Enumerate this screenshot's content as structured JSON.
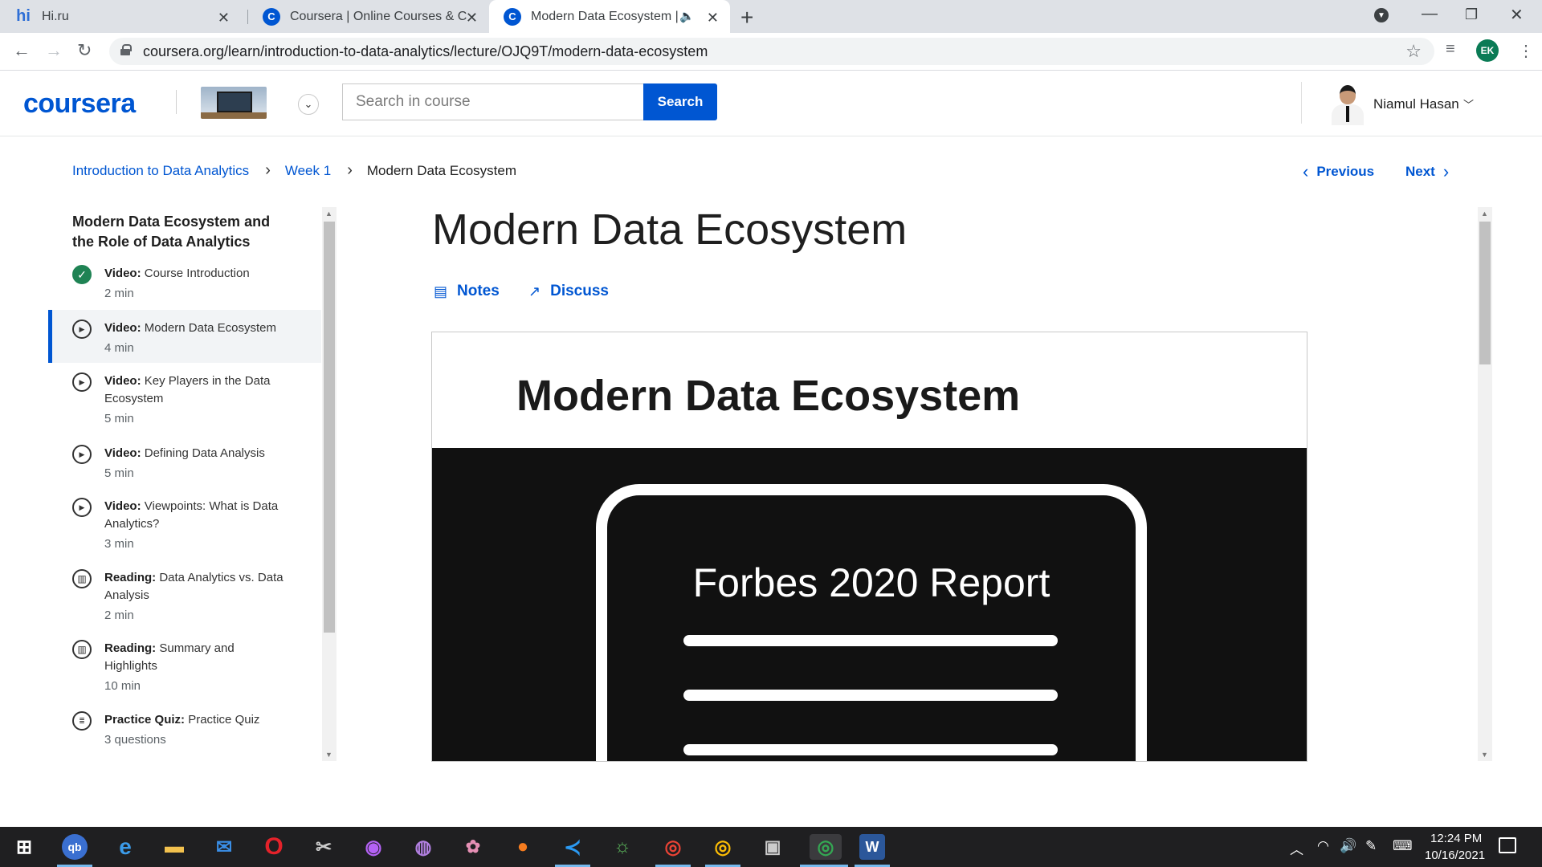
{
  "browser": {
    "tabs": [
      {
        "favicon": "hi",
        "title": "Hi.ru",
        "active": false
      },
      {
        "favicon": "coursera-c",
        "title": "Coursera | Online Courses & Cred",
        "active": false
      },
      {
        "favicon": "coursera-c",
        "title": "Modern Data Ecosystem | Co",
        "active": true,
        "audio": true
      }
    ],
    "url": "coursera.org/learn/introduction-to-data-analytics/lecture/OJQ9T/modern-data-ecosystem",
    "profile_initials": "EK"
  },
  "header": {
    "logo": "coursera",
    "search_placeholder": "Search in course",
    "search_button": "Search",
    "user_name": "Niamul Hasan"
  },
  "breadcrumb": {
    "course": "Introduction to Data Analytics",
    "week": "Week 1",
    "current": "Modern Data Ecosystem"
  },
  "pager": {
    "previous": "Previous",
    "next": "Next"
  },
  "sidebar": {
    "module_title": "Modern Data Ecosystem and the Role of Data Analytics",
    "items": [
      {
        "type": "Video:",
        "title": "Course Introduction",
        "duration": "2 min",
        "status": "done"
      },
      {
        "type": "Video:",
        "title": "Modern Data Ecosystem",
        "duration": "4 min",
        "status": "active"
      },
      {
        "type": "Video:",
        "title": "Key Players in the Data Ecosystem",
        "duration": "5 min",
        "status": "todo"
      },
      {
        "type": "Video:",
        "title": "Defining Data Analysis",
        "duration": "5 min",
        "status": "todo"
      },
      {
        "type": "Video:",
        "title": "Viewpoints: What is Data Analytics?",
        "duration": "3 min",
        "status": "todo"
      },
      {
        "type": "Reading:",
        "title": "Data Analytics vs. Data Analysis",
        "duration": "2 min",
        "status": "todo"
      },
      {
        "type": "Reading:",
        "title": "Summary and Highlights",
        "duration": "10 min",
        "status": "todo"
      },
      {
        "type": "Practice Quiz:",
        "title": "Practice Quiz",
        "duration": "3 questions",
        "status": "todo"
      }
    ]
  },
  "lecture": {
    "title": "Modern Data Ecosystem",
    "notes_label": "Notes",
    "discuss_label": "Discuss",
    "slide_title": "Modern Data Ecosystem",
    "slide_doc_title": "Forbes 2020 Report"
  },
  "taskbar": {
    "time": "12:24 PM",
    "date": "10/16/2021"
  },
  "colors": {
    "brand": "#0056d2",
    "done": "#1f8354"
  }
}
